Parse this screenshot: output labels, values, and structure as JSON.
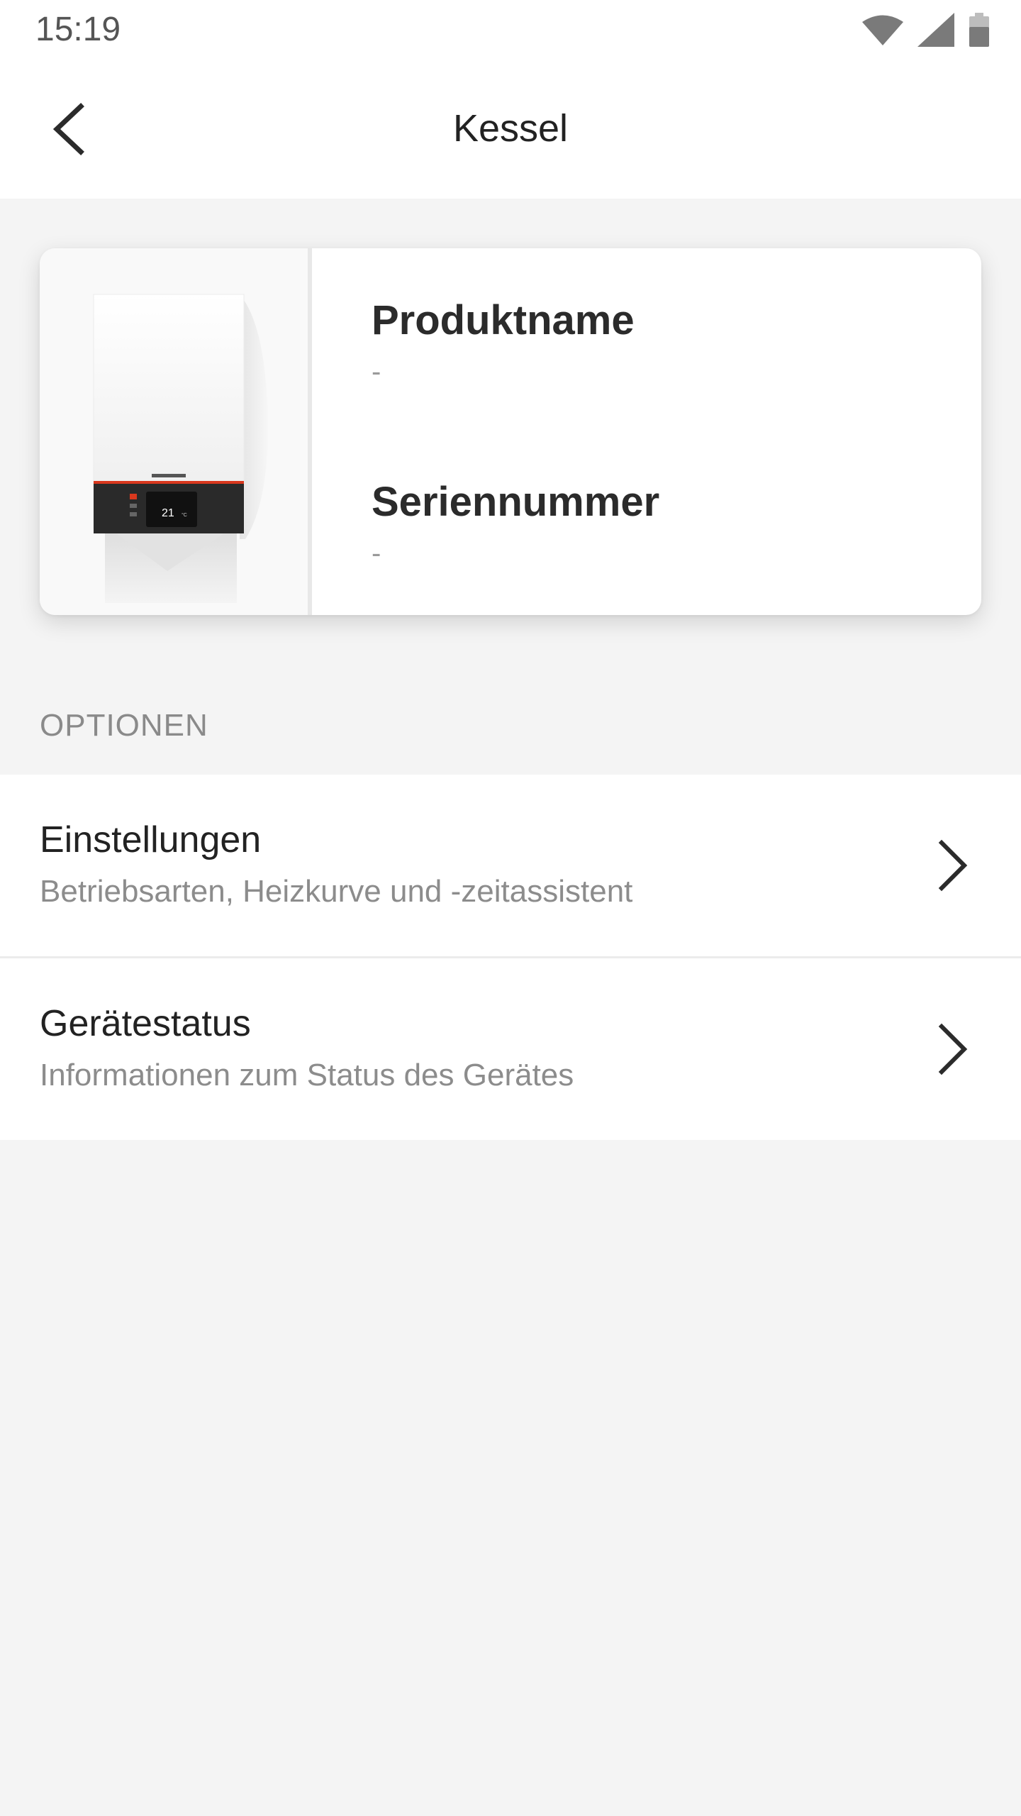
{
  "status_bar": {
    "time": "15:19",
    "icons": [
      "wifi-icon",
      "cellular-signal-icon",
      "battery-icon"
    ]
  },
  "app_bar": {
    "title": "Kessel",
    "back_icon": "chevron-left-icon"
  },
  "device_card": {
    "image": "boiler-image",
    "product_name_label": "Produktname",
    "product_name_value": "-",
    "serial_number_label": "Seriennummer",
    "serial_number_value": "-",
    "display_temperature": "21"
  },
  "options": {
    "header": "OPTIONEN",
    "items": [
      {
        "title": "Einstellungen",
        "subtitle": "Betriebsarten, Heizkurve und -zeitassistent",
        "icon": "chevron-right-icon"
      },
      {
        "title": "Gerätestatus",
        "subtitle": "Informationen zum Status des Gerätes",
        "icon": "chevron-right-icon"
      }
    ]
  },
  "colors": {
    "background": "#f4f4f4",
    "surface": "#ffffff",
    "accent_red": "#d9381e",
    "text_primary": "#222222",
    "text_secondary": "#8c8c8c"
  }
}
